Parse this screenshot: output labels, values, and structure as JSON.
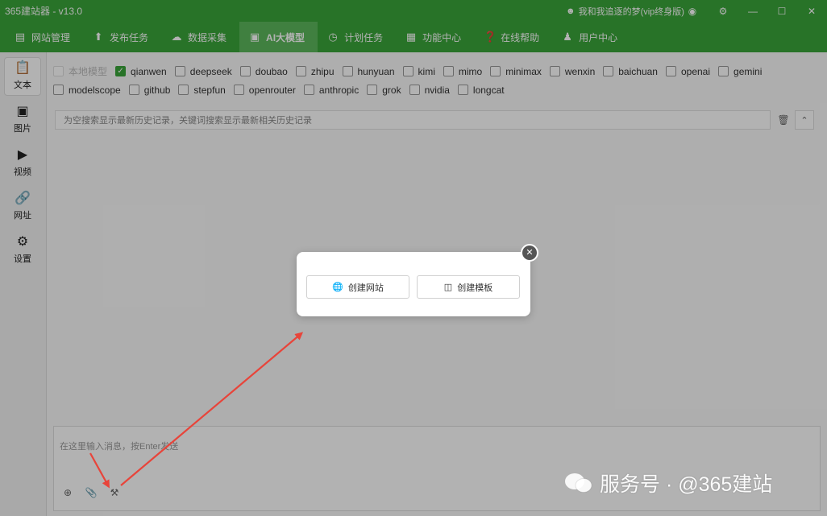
{
  "titlebar": {
    "app_title": "365建站器 - v13.0",
    "user": "我和我追逐的梦(vip终身版)",
    "icons": [
      "skin-icon",
      "settings-icon",
      "minimize-icon",
      "maximize-icon",
      "close-icon"
    ]
  },
  "nav": {
    "items": [
      {
        "label": "网站管理",
        "icon": "server-icon"
      },
      {
        "label": "发布任务",
        "icon": "upload-icon"
      },
      {
        "label": "数据采集",
        "icon": "cloud-download-icon"
      },
      {
        "label": "AI大模型",
        "icon": "ai-icon",
        "active": true
      },
      {
        "label": "计划任务",
        "icon": "clock-icon"
      },
      {
        "label": "功能中心",
        "icon": "grid-icon"
      },
      {
        "label": "在线帮助",
        "icon": "help-icon"
      },
      {
        "label": "用户中心",
        "icon": "user-icon"
      }
    ]
  },
  "sidebar": {
    "items": [
      {
        "label": "文本",
        "icon": "document-icon",
        "active": true
      },
      {
        "label": "图片",
        "icon": "image-icon"
      },
      {
        "label": "视频",
        "icon": "video-icon"
      },
      {
        "label": "网址",
        "icon": "link-icon"
      },
      {
        "label": "设置",
        "icon": "gear-icon"
      }
    ]
  },
  "models": {
    "row1": [
      {
        "label": "本地模型",
        "checked": false,
        "disabled": true
      },
      {
        "label": "qianwen",
        "checked": true
      },
      {
        "label": "deepseek",
        "checked": false
      },
      {
        "label": "doubao",
        "checked": false
      },
      {
        "label": "zhipu",
        "checked": false
      },
      {
        "label": "hunyuan",
        "checked": false
      },
      {
        "label": "kimi",
        "checked": false
      },
      {
        "label": "mimo",
        "checked": false
      },
      {
        "label": "minimax",
        "checked": false
      },
      {
        "label": "wenxin",
        "checked": false
      },
      {
        "label": "baichuan",
        "checked": false
      },
      {
        "label": "openai",
        "checked": false
      },
      {
        "label": "gemini",
        "checked": false
      }
    ],
    "row2": [
      {
        "label": "modelscope",
        "checked": false
      },
      {
        "label": "github",
        "checked": false
      },
      {
        "label": "stepfun",
        "checked": false
      },
      {
        "label": "openrouter",
        "checked": false
      },
      {
        "label": "anthropic",
        "checked": false
      },
      {
        "label": "grok",
        "checked": false
      },
      {
        "label": "nvidia",
        "checked": false
      },
      {
        "label": "longcat",
        "checked": false
      }
    ]
  },
  "search": {
    "placeholder": "为空搜索显示最新历史记录，关键词搜索显示最新相关历史记录"
  },
  "chat": {
    "placeholder": "在这里输入消息，按Enter发送"
  },
  "popup": {
    "create_site": "创建网站",
    "create_template": "创建模板"
  },
  "watermark": {
    "text": "服务号 · @365建站"
  },
  "colors": {
    "brand_green": "#3aa53a",
    "active_nav": "#5cb85c",
    "arrow_red": "#e8443a"
  }
}
